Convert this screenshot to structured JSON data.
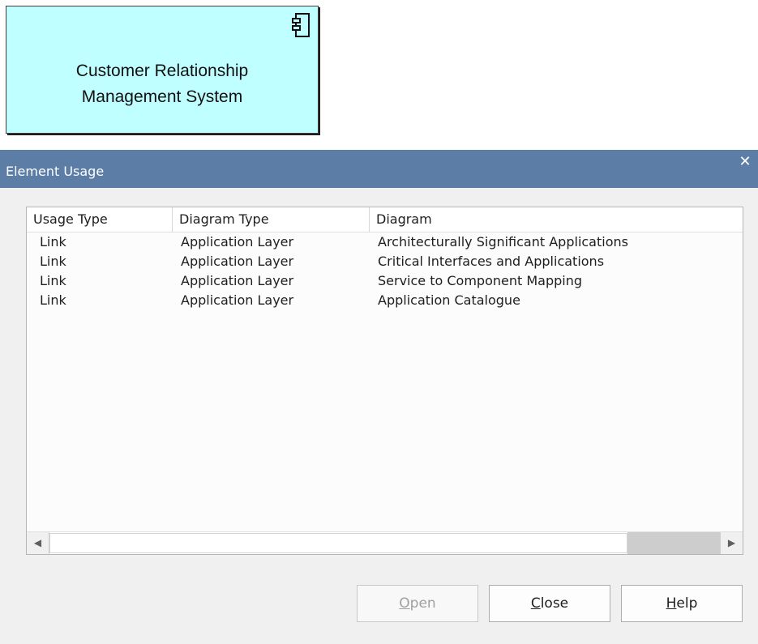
{
  "component": {
    "title_line1": "Customer Relationship",
    "title_line2": "Management System",
    "icon": "component-icon",
    "fill_color": "#c0ffff"
  },
  "dialog": {
    "title": "Element Usage",
    "close_glyph": "✕",
    "titlebar_color": "#5b7da6",
    "columns": [
      "Usage Type",
      "Diagram Type",
      "Diagram"
    ],
    "rows": [
      {
        "usage_type": "Link",
        "diagram_type": "Application Layer",
        "diagram": "Architecturally Significant Applications"
      },
      {
        "usage_type": "Link",
        "diagram_type": "Application Layer",
        "diagram": "Critical Interfaces and Applications"
      },
      {
        "usage_type": "Link",
        "diagram_type": "Application Layer",
        "diagram": "Service to Component Mapping"
      },
      {
        "usage_type": "Link",
        "diagram_type": "Application Layer",
        "diagram": "Application Catalogue"
      }
    ],
    "scroll_left_glyph": "◀",
    "scroll_right_glyph": "▶",
    "buttons": {
      "open": {
        "accel": "O",
        "rest": "pen",
        "disabled": true
      },
      "close": {
        "accel": "C",
        "rest": "lose"
      },
      "help": {
        "accel": "H",
        "rest": "elp"
      }
    }
  }
}
